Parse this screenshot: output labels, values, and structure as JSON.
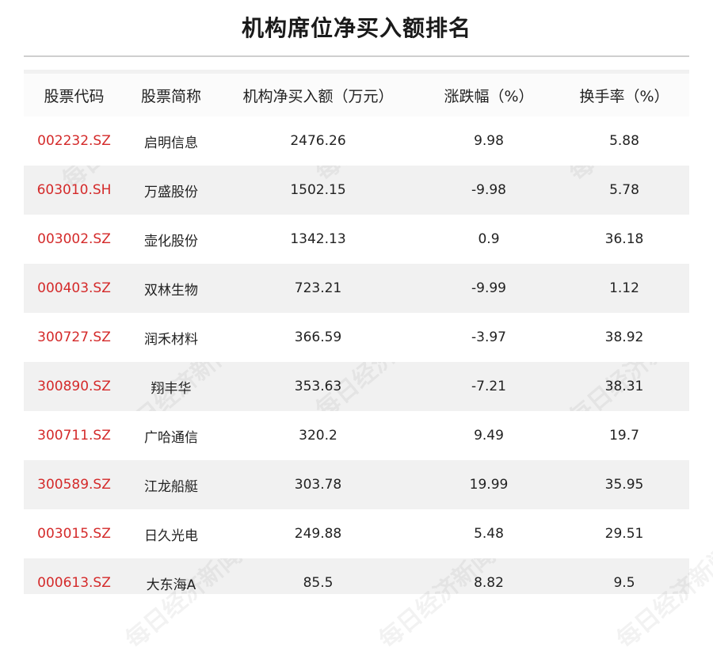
{
  "title": "机构席位净买入额排名",
  "watermark": "每日经济新闻",
  "colors": {
    "code_text": "#d42a2a",
    "panel_bg": "#f1f1f1",
    "row_bg": "#ffffff"
  },
  "table": {
    "headers": [
      "股票代码",
      "股票简称",
      "机构净买入额（万元）",
      "涨跌幅（%）",
      "换手率（%）"
    ],
    "rows": [
      {
        "code": "002232.SZ",
        "name": "启明信息",
        "net_buy": "2476.26",
        "change": "9.98",
        "turnover": "5.88"
      },
      {
        "code": "603010.SH",
        "name": "万盛股份",
        "net_buy": "1502.15",
        "change": "-9.98",
        "turnover": "5.78"
      },
      {
        "code": "003002.SZ",
        "name": "壶化股份",
        "net_buy": "1342.13",
        "change": "0.9",
        "turnover": "36.18"
      },
      {
        "code": "000403.SZ",
        "name": "双林生物",
        "net_buy": "723.21",
        "change": "-9.99",
        "turnover": "1.12"
      },
      {
        "code": "300727.SZ",
        "name": "润禾材料",
        "net_buy": "366.59",
        "change": "-3.97",
        "turnover": "38.92"
      },
      {
        "code": "300890.SZ",
        "name": "翔丰华",
        "net_buy": "353.63",
        "change": "-7.21",
        "turnover": "38.31"
      },
      {
        "code": "300711.SZ",
        "name": "广哈通信",
        "net_buy": "320.2",
        "change": "9.49",
        "turnover": "19.7"
      },
      {
        "code": "300589.SZ",
        "name": "江龙船艇",
        "net_buy": "303.78",
        "change": "19.99",
        "turnover": "35.95"
      },
      {
        "code": "003015.SZ",
        "name": "日久光电",
        "net_buy": "249.88",
        "change": "5.48",
        "turnover": "29.51"
      },
      {
        "code": "000613.SZ",
        "name": "大东海A",
        "net_buy": "85.5",
        "change": "8.82",
        "turnover": "9.5"
      }
    ]
  }
}
